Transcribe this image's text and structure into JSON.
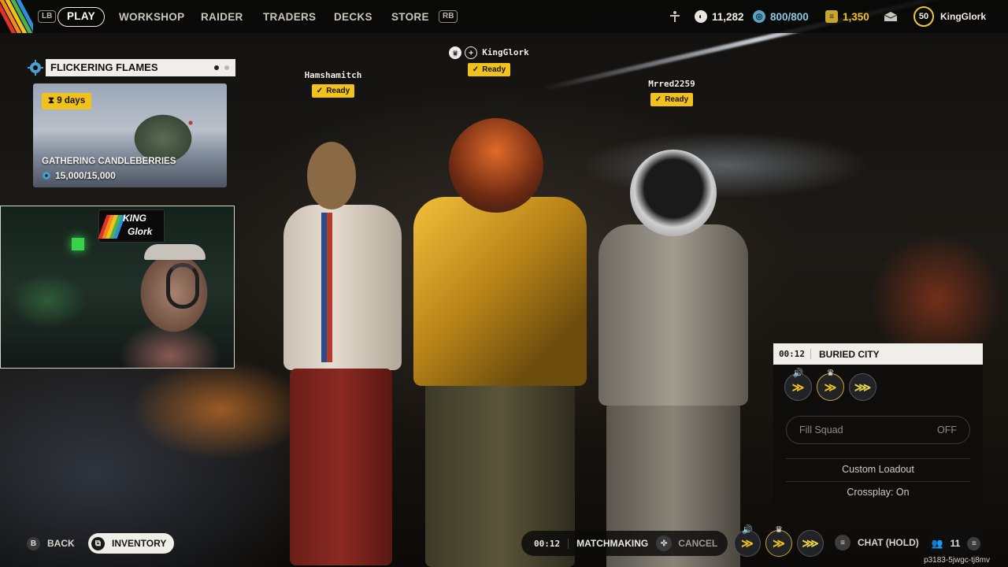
{
  "colors": {
    "accent_yellow": "#f2c21c",
    "panel_light": "#efeee8",
    "ready_text": "#121212",
    "stripe_colors": [
      "#e2312a",
      "#f08a1c",
      "#f2c21c",
      "#4bb34e",
      "#2d8fd8"
    ]
  },
  "topbar": {
    "left_bumper": "LB",
    "right_bumper": "RB",
    "nav": [
      "PLAY",
      "WORKSHOP",
      "RAIDER",
      "TRADERS",
      "DECKS",
      "STORE"
    ],
    "active_nav": "PLAY",
    "currencies": [
      {
        "icon": "coin-icon",
        "value": "11,282"
      },
      {
        "icon": "raider-token-icon",
        "value": "800/800"
      },
      {
        "icon": "credits-icon",
        "value": "1,350"
      }
    ],
    "player_level": "50",
    "player_name": "KingGlork"
  },
  "event": {
    "title": "FLICKERING FLAMES",
    "time_left": "9 days",
    "name": "GATHERING CANDLEBERRIES",
    "progress": "15,000/15,000"
  },
  "webcam": {
    "sign_line1": "KING",
    "sign_line2": "Glork"
  },
  "squad_members": [
    {
      "name": "Hamshamitch",
      "status": "Ready"
    },
    {
      "name": "KingGlork",
      "status": "Ready"
    },
    {
      "name": "Mrred2259",
      "status": "Ready"
    }
  ],
  "squad_panel": {
    "timer": "00:12",
    "map": "BURIED CITY",
    "fill_squad_label": "Fill Squad",
    "fill_squad_value": "OFF",
    "custom_loadout": "Custom Loadout",
    "crossplay": "Crossplay: On"
  },
  "bottom": {
    "back_key": "B",
    "back_label": "BACK",
    "inventory_label": "INVENTORY",
    "mm_timer": "00:12",
    "matchmaking_label": "MATCHMAKING",
    "cancel_label": "CANCEL",
    "chat_label": "CHAT (HOLD)",
    "friends_count": "11",
    "session_code": "p3183-5jwgc-tj8mv"
  }
}
